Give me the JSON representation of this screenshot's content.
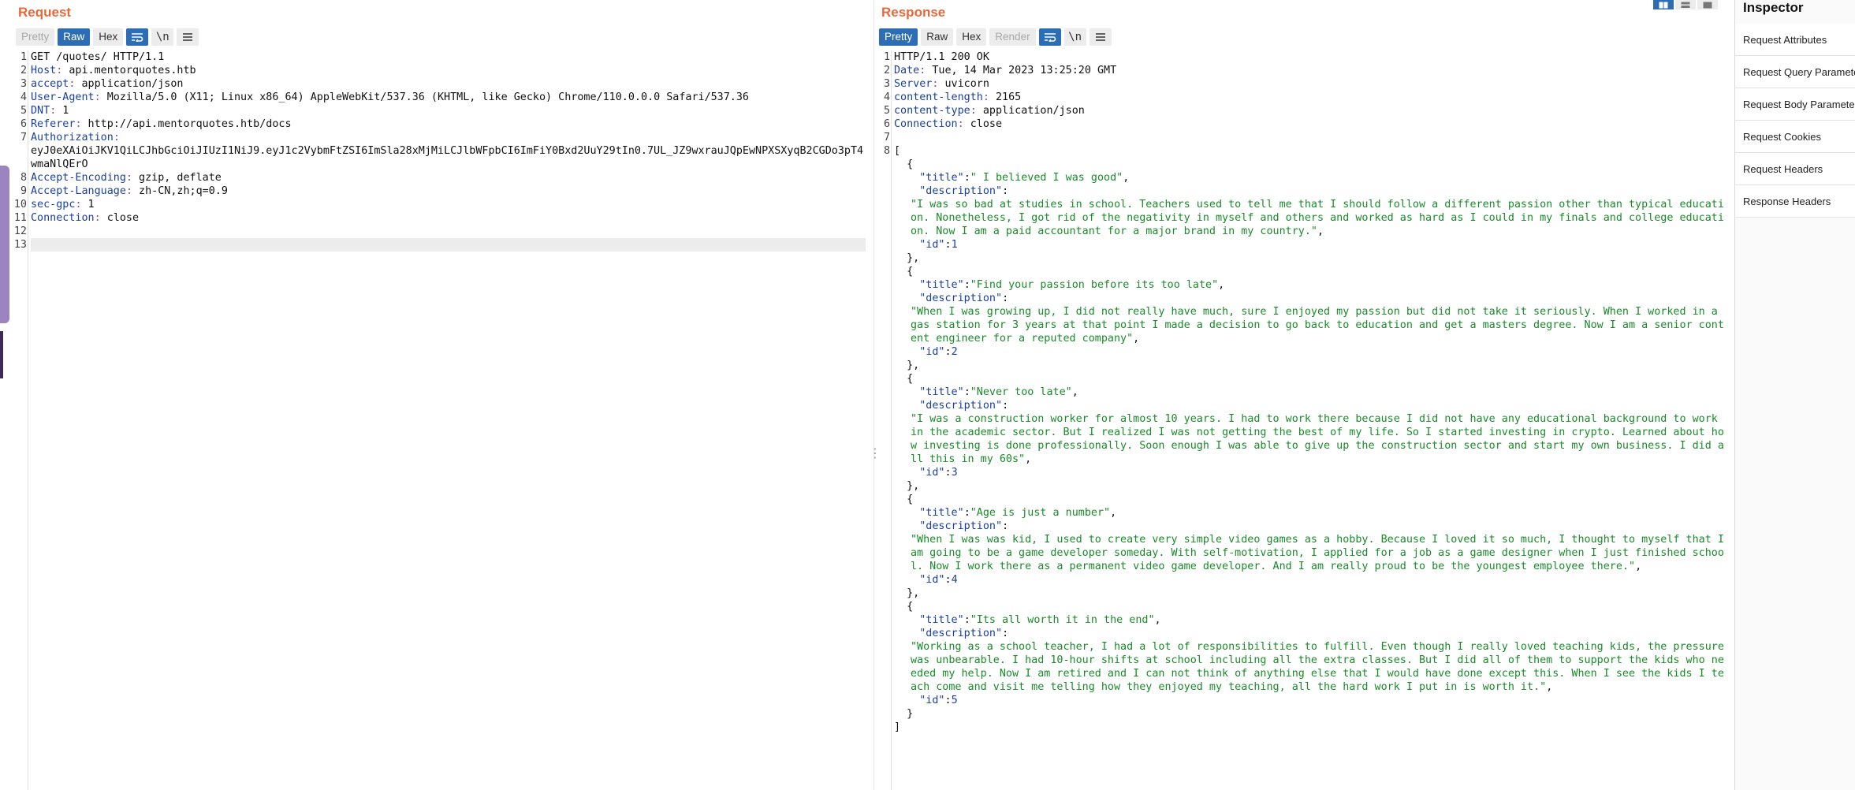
{
  "request": {
    "title": "Request",
    "tabs": [
      "Pretty",
      "Raw",
      "Hex"
    ],
    "active_tab": "Raw",
    "newline_label": "\\n",
    "lines": [
      {
        "n": "1",
        "head": "GET /quotes/ HTTP/1.1",
        "name": "",
        "value": ""
      },
      {
        "n": "2",
        "head": "",
        "name": "Host",
        "value": " api.mentorquotes.htb"
      },
      {
        "n": "3",
        "head": "",
        "name": "accept",
        "value": " application/json"
      },
      {
        "n": "4",
        "head": "",
        "name": "User-Agent",
        "value": " Mozilla/5.0 (X11; Linux x86_64) AppleWebKit/537.36 (KHTML, like Gecko) Chrome/110.0.0.0 Safari/537.36"
      },
      {
        "n": "5",
        "head": "",
        "name": "DNT",
        "value": " 1"
      },
      {
        "n": "6",
        "head": "",
        "name": "Referer",
        "value": " http://api.mentorquotes.htb/docs"
      },
      {
        "n": "7",
        "head": "",
        "name": "Authorization",
        "value": "\neyJ0eXAiOiJKV1QiLCJhbGciOiJIUzI1NiJ9.eyJ1c2VybmFtZSI6ImSla28xMjMiLCJlbWFpbCI6ImFiY0Bxd2UuY29tIn0.7UL_JZ9wxrauJQpEwNPXSXyqB2CGDo3pT4wmaNlQErO"
      },
      {
        "n": "8",
        "head": "",
        "name": "Accept-Encoding",
        "value": " gzip, deflate"
      },
      {
        "n": "9",
        "head": "",
        "name": "Accept-Language",
        "value": " zh-CN,zh;q=0.9"
      },
      {
        "n": "10",
        "head": "",
        "name": "sec-gpc",
        "value": " 1"
      },
      {
        "n": "11",
        "head": "",
        "name": "Connection",
        "value": " close"
      },
      {
        "n": "12",
        "head": "",
        "name": "",
        "value": ""
      },
      {
        "n": "13",
        "head": "",
        "name": "",
        "value": ""
      }
    ]
  },
  "response": {
    "title": "Response",
    "tabs": [
      "Pretty",
      "Raw",
      "Hex",
      "Render"
    ],
    "active_tab": "Pretty",
    "newline_label": "\\n",
    "header_lines": [
      {
        "n": "1",
        "head": "HTTP/1.1 200 OK",
        "name": "",
        "value": ""
      },
      {
        "n": "2",
        "head": "",
        "name": "Date",
        "value": " Tue, 14 Mar 2023 13:25:20 GMT"
      },
      {
        "n": "3",
        "head": "",
        "name": "Server",
        "value": " uvicorn"
      },
      {
        "n": "4",
        "head": "",
        "name": "content-length",
        "value": " 2165"
      },
      {
        "n": "5",
        "head": "",
        "name": "content-type",
        "value": " application/json"
      },
      {
        "n": "6",
        "head": "",
        "name": "Connection",
        "value": " close"
      },
      {
        "n": "7",
        "head": "",
        "name": "",
        "value": ""
      }
    ],
    "body_line_number": "8",
    "quotes": [
      {
        "title": "\" I believed I was good\"",
        "description": "\"I was so bad at studies in school. Teachers used to tell me that I should follow a different passion other than typical education. Nonetheless, I got rid of the negativity in myself and others and worked as hard as I could in my finals and college education. Now I am a paid accountant for a major brand in my country.\"",
        "id": "1"
      },
      {
        "title": "\"Find your passion before its too late\"",
        "description": "\"When I was growing up, I did not really have much, sure I enjoyed my passion but did not take it seriously. When I worked in a gas station for 3 years at that point I made a decision to go back to education and get a masters degree. Now I am a senior content engineer for a reputed company\"",
        "id": "2"
      },
      {
        "title": "\"Never too late\"",
        "description": "\"I was a construction worker for almost 10 years. I had to work there because I did not have any educational background to work in the academic sector. But I realized I was not getting the best of my life. So I started investing in crypto. Learned about how investing is done professionally. Soon enough I was able to give up the construction sector and start my own business. I did all this in my 60s\"",
        "id": "3"
      },
      {
        "title": "\"Age is just a number\"",
        "description": "\"When I was was kid, I used to create very simple video games as a hobby. Because I loved it so much, I thought to myself that I am going to be a game developer someday. With self-motivation, I applied for a job as a game designer when I just finished school. Now I work there as a permanent video game developer. And I am really proud to be the youngest employee there.\"",
        "id": "4"
      },
      {
        "title": "\"Its all worth it in the end\"",
        "description": "\"Working as a school teacher, I had a lot of responsibilities to fulfill. Even though I really loved teaching kids, the pressure was unbearable. I had 10-hour shifts at school including all the extra classes. But I did all of them to support the kids who needed my help. Now I am retired and I can not think of anything else that I would have done except this. When I see the kids I teach come and visit me telling how they enjoyed my teaching, all the hard work I put in is worth it.\"",
        "id": "5"
      }
    ]
  },
  "inspector": {
    "title": "Inspector",
    "items": [
      "Request Attributes",
      "Request Query Parameters",
      "Request Body Parameters",
      "Request Cookies",
      "Request Headers",
      "Response Headers"
    ]
  },
  "colors": {
    "accent_orange": "#e8683c",
    "active_blue": "#2d6db5",
    "json_string": "#1a8a2a",
    "json_key": "#1b3fa0"
  }
}
